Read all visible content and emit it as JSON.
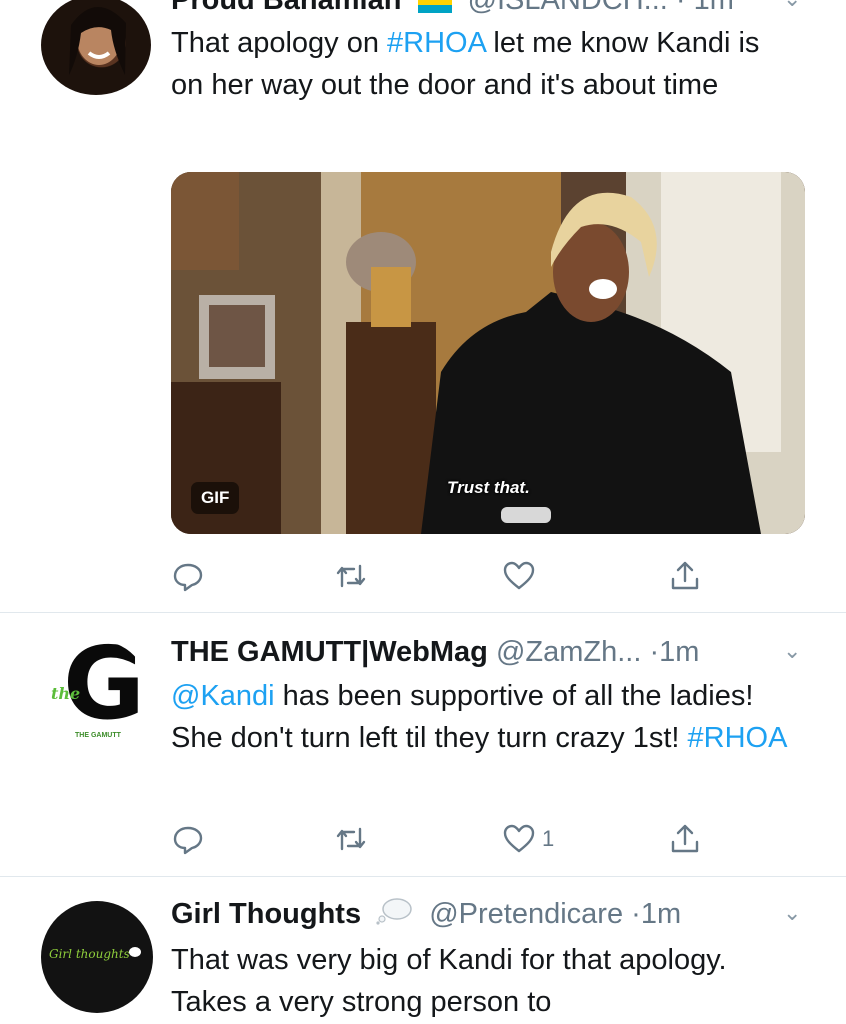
{
  "tweets": [
    {
      "name": "Proud Bahamian",
      "handle": "@ISLANDCH...",
      "time": "1m",
      "text_before": "That apology on ",
      "hashtag": "#RHOA",
      "text_after": " let me know Kandi is on her way out the door and it's about time",
      "media": {
        "badge": "GIF",
        "caption": "Trust that."
      },
      "actions": {
        "reply": "",
        "retweet": "",
        "like": "",
        "share": ""
      }
    },
    {
      "name": "THE GAMUTT|WebMag",
      "handle": "@ZamZh...",
      "time": "1m",
      "mention": "@Kandi",
      "text_mid": " has been supportive of all the ladies! She don't turn left til they turn crazy 1st! ",
      "hashtag": "#RHOA",
      "avatar_letter": "G",
      "avatar_script": "the",
      "avatar_caption": "THE GAMUTT",
      "actions": {
        "reply": "",
        "retweet": "",
        "like": "1",
        "share": ""
      }
    },
    {
      "name": "Girl Thoughts",
      "handle": "@Pretendicare",
      "time": "1m",
      "text": "That was very big of Kandi for that apology. Takes a very strong person to",
      "avatar_text": "Girl thoughts"
    }
  ],
  "colors": {
    "link": "#1da1f2",
    "secondary": "#657786",
    "like_accent": "#e0245e"
  }
}
